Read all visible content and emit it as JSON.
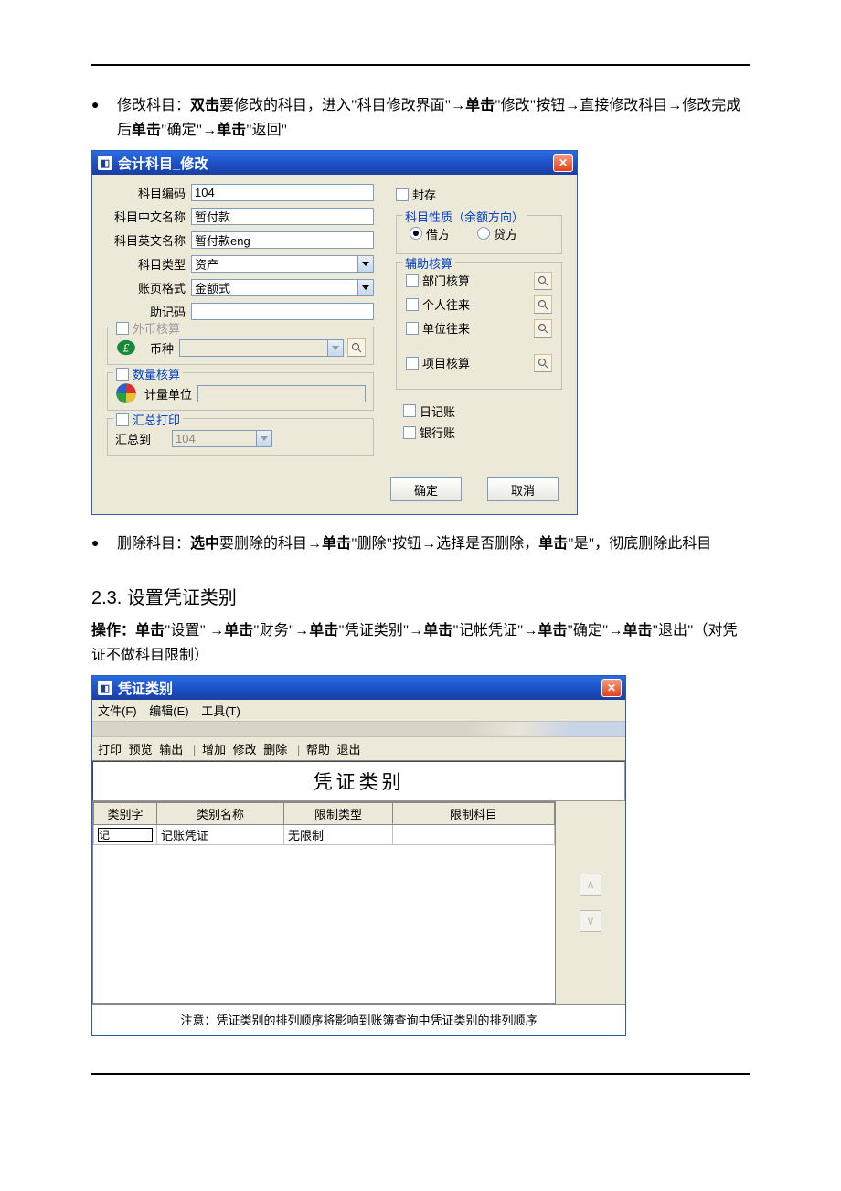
{
  "doc": {
    "bullet1_pre": "修改科目：",
    "bullet1_b1": "双击",
    "bullet1_t1": "要修改的科目，进入\"科目修改界面\"→",
    "bullet1_b2": "单击",
    "bullet1_t2": "\"修改\"按钮→直接修改科目→修改完成后",
    "bullet1_b3": "单击",
    "bullet1_t3": "\"确定\"→",
    "bullet1_b4": "单击",
    "bullet1_t4": "\"返回\"",
    "bullet2_pre": "删除科目：",
    "bullet2_b1": "选中",
    "bullet2_t1": "要删除的科目→",
    "bullet2_b2": "单击",
    "bullet2_t2": "\"删除\"按钮→选择是否删除，",
    "bullet2_b3": "单击",
    "bullet2_t3": "\"是\"，彻底删除此科目",
    "section": "2.3.  设置凭证类别",
    "op_b1": "操作：单击",
    "op_t1": "\"设置\" →",
    "op_b2": "单击",
    "op_t2": "\"财务\"→",
    "op_b3": "单击",
    "op_t3": "\"凭证类别\"→",
    "op_b4": "单击",
    "op_t4": "\"记帐凭证\"→",
    "op_b5": "单击",
    "op_t5": "\"确定\"→",
    "op_b6": "单击",
    "op_t6": "\"退出\"（对凭证不做科目限制）"
  },
  "dlg1": {
    "title": "会计科目_修改",
    "labels": {
      "code": "科目编码",
      "cname": "科目中文名称",
      "ename": "科目英文名称",
      "type": "科目类型",
      "format": "账页格式",
      "mnemonic": "助记码",
      "fx_group": "外币核算",
      "currency": "币种",
      "qty_group": "数量核算",
      "unit": "计量单位",
      "sum_group": "汇总打印",
      "sum_to": "汇总到",
      "seal": "封存",
      "nature_group": "科目性质（余额方向）",
      "debit": "借方",
      "credit": "贷方",
      "aux_group": "辅助核算",
      "dept": "部门核算",
      "personal": "个人往来",
      "unit_contact": "单位往来",
      "project": "项目核算",
      "journal": "日记账",
      "bank": "银行账"
    },
    "values": {
      "code": "104",
      "cname": "暂付款",
      "ename": "暂付款eng",
      "type": "资产",
      "format": "金额式",
      "mnemonic": "",
      "sum_to": "104"
    },
    "buttons": {
      "ok": "确定",
      "cancel": "取消"
    }
  },
  "dlg2": {
    "title": "凭证类别",
    "menu": {
      "file": "文件(F)",
      "edit": "编辑(E)",
      "tool": "工具(T)"
    },
    "toolbar": {
      "print": "打印",
      "preview": "预览",
      "output": "输出",
      "add": "增加",
      "modify": "修改",
      "del": "删除",
      "help": "帮助",
      "exit": "退出"
    },
    "panel_title": "凭证类别",
    "cols": {
      "char": "类别字",
      "name": "类别名称",
      "restrict_type": "限制类型",
      "restrict_subject": "限制科目"
    },
    "row": {
      "char": "记",
      "name": "记账凭证",
      "restrict_type": "无限制",
      "restrict_subject": ""
    },
    "note": "注意：凭证类别的排列顺序将影响到账簿查询中凭证类别的排列顺序"
  }
}
